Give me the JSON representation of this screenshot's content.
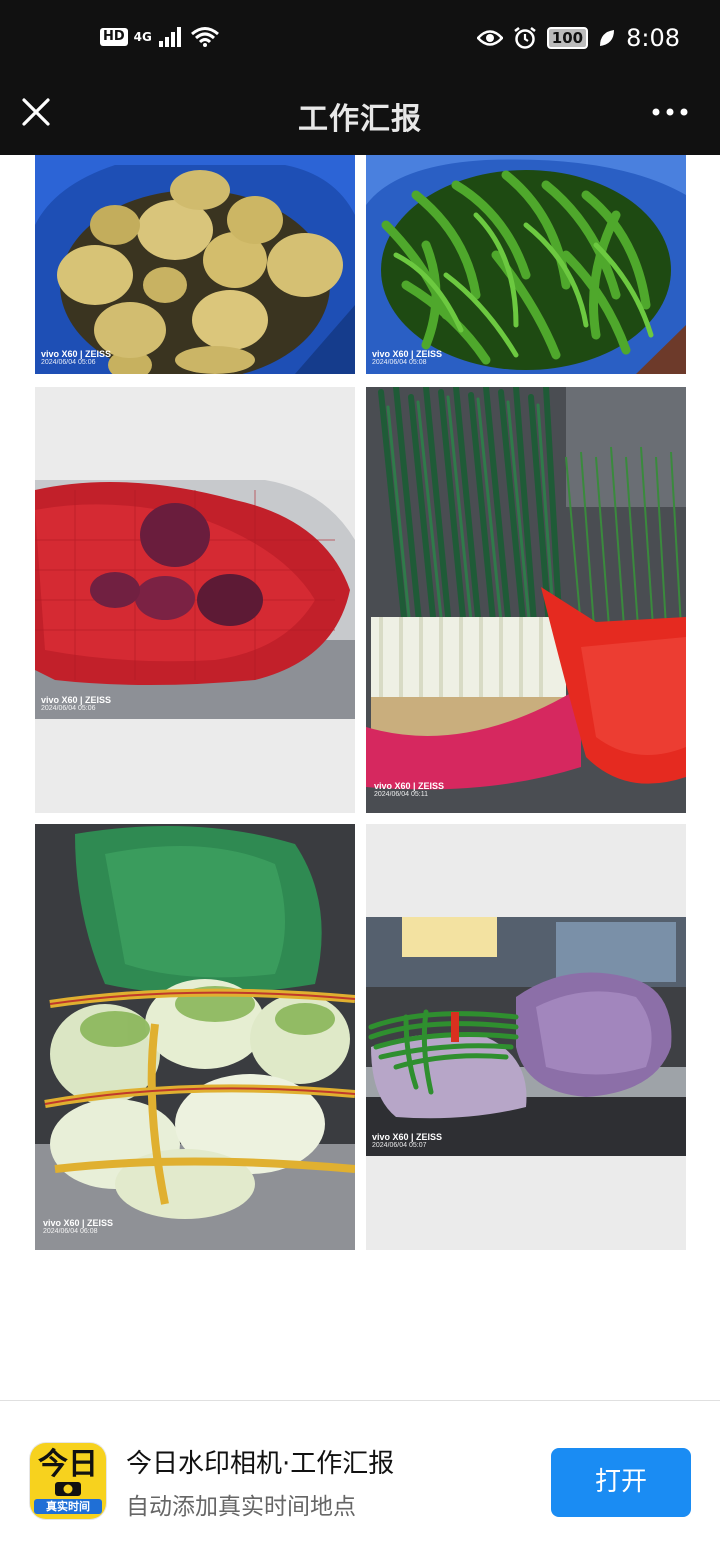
{
  "status_bar": {
    "hd": "HD",
    "network": "4G",
    "battery": "100",
    "time": "8:08"
  },
  "header": {
    "title": "工作汇报"
  },
  "photos": [
    {
      "subject": "potatoes",
      "camera": "vivo X60 | ZEISS",
      "timestamp": "2024/06/04 05:06"
    },
    {
      "subject": "green-chilies",
      "camera": "vivo X60 | ZEISS",
      "timestamp": "2024/06/04 05:08"
    },
    {
      "subject": "red-onions",
      "camera": "vivo X60 | ZEISS",
      "timestamp": "2024/06/04 05:06"
    },
    {
      "subject": "green-onions",
      "camera": "vivo X60 | ZEISS",
      "timestamp": "2024/06/04 05:11"
    },
    {
      "subject": "napa-cabbage",
      "camera": "vivo X60 | ZEISS",
      "timestamp": "2024/06/04 06:08"
    },
    {
      "subject": "leafy-greens",
      "camera": "vivo X60 | ZEISS",
      "timestamp": "2024/06/04 05:07"
    }
  ],
  "banner": {
    "icon_top": "今日",
    "icon_bottom": "真实时间",
    "app_name": "今日水印相机·工作汇报",
    "description": "自动添加真实时间地点",
    "open_button": "打开"
  },
  "colors": {
    "dark_bar": "#111111",
    "open_button": "#1a8cf3",
    "icon_yellow": "#f7d21e"
  }
}
